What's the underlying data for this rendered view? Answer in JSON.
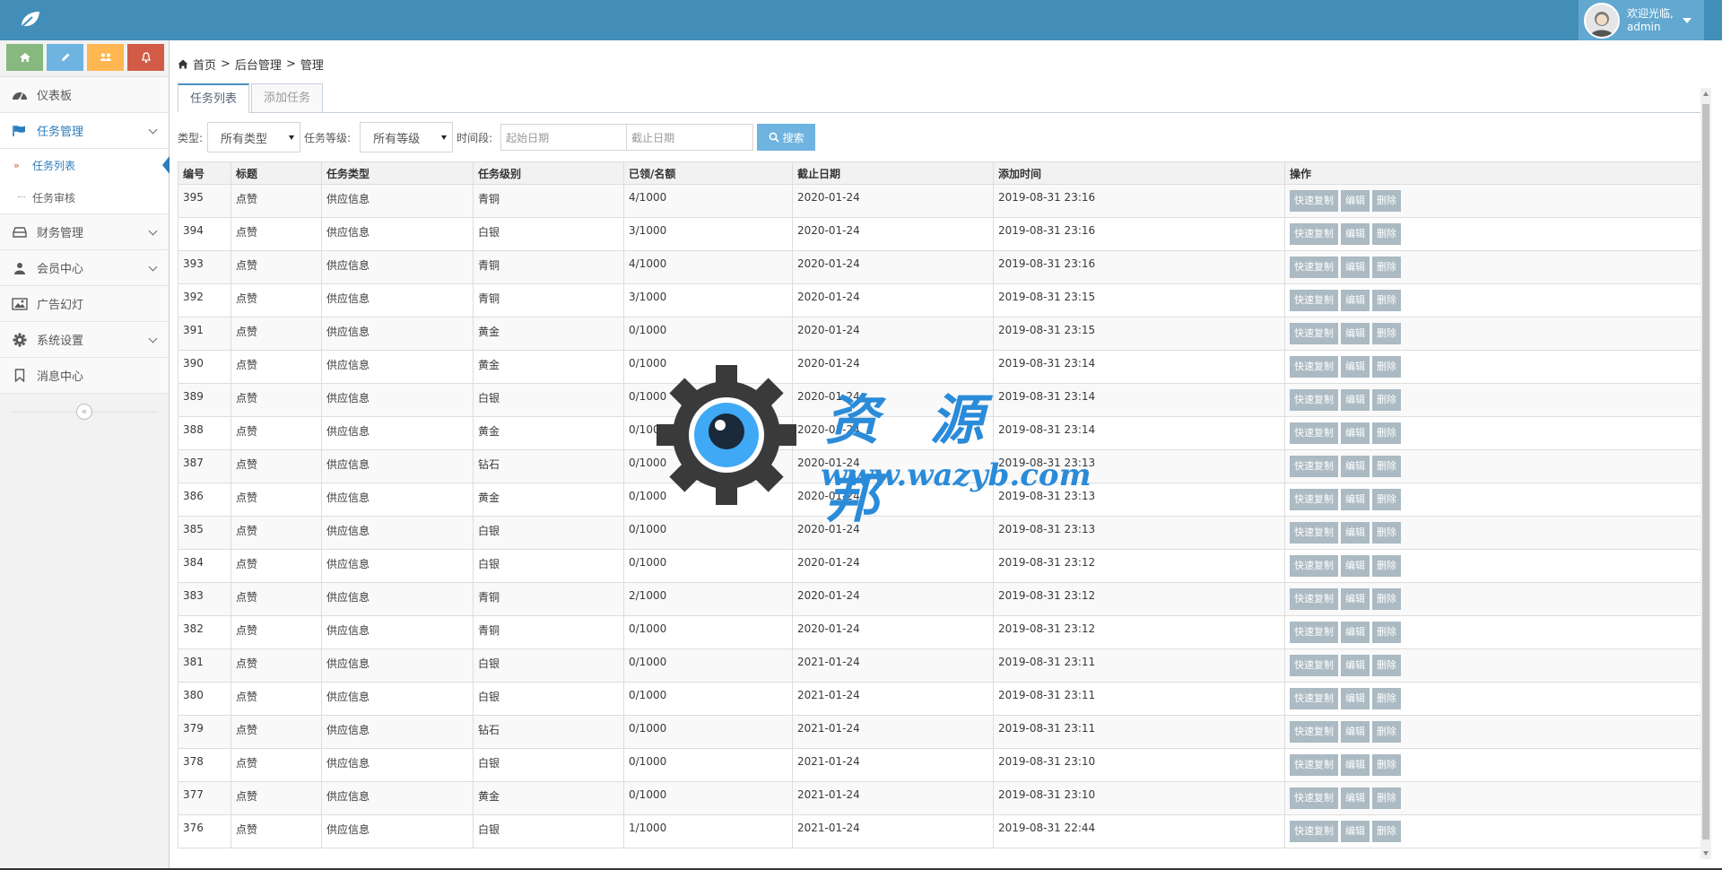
{
  "header": {
    "welcome": "欢迎光临,",
    "username": "admin"
  },
  "sidebar": {
    "shortcut_colors": [
      "#87b87f",
      "#6fb3e0",
      "#ffb752",
      "#d15b47"
    ],
    "items": [
      {
        "label": "仪表板",
        "icon": "dashboard-icon"
      },
      {
        "label": "任务管理",
        "icon": "flag-icon",
        "expanded": true
      },
      {
        "label": "财务管理",
        "icon": "hdd-icon"
      },
      {
        "label": "会员中心",
        "icon": "user-icon"
      },
      {
        "label": "广告幻灯",
        "icon": "picture-icon"
      },
      {
        "label": "系统设置",
        "icon": "cog-icon"
      },
      {
        "label": "消息中心",
        "icon": "bookmark-icon"
      }
    ],
    "submenu": [
      {
        "label": "任务列表",
        "active": true
      },
      {
        "label": "任务审核"
      }
    ]
  },
  "breadcrumb": {
    "home": "首页",
    "sep": ">",
    "level2": "后台管理",
    "level3": "管理"
  },
  "tabs": {
    "list": "任务列表",
    "add": "添加任务"
  },
  "filters": {
    "type_label": "类型:",
    "type_value": "所有类型",
    "level_label": "任务等级:",
    "level_value": "所有等级",
    "period_label": "时间段:",
    "start_placeholder": "起始日期",
    "end_placeholder": "截止日期",
    "search_label": "搜索"
  },
  "table": {
    "headers": [
      "编号",
      "标题",
      "任务类型",
      "任务级别",
      "已领/名额",
      "截止日期",
      "添加时间",
      "操作"
    ],
    "actions": [
      "快速复制",
      "编辑",
      "删除"
    ],
    "rows": [
      [
        "395",
        "点赞",
        "供应信息",
        "青铜",
        "4/1000",
        "2020-01-24",
        "2019-08-31 23:16"
      ],
      [
        "394",
        "点赞",
        "供应信息",
        "白银",
        "3/1000",
        "2020-01-24",
        "2019-08-31 23:16"
      ],
      [
        "393",
        "点赞",
        "供应信息",
        "青铜",
        "4/1000",
        "2020-01-24",
        "2019-08-31 23:16"
      ],
      [
        "392",
        "点赞",
        "供应信息",
        "青铜",
        "3/1000",
        "2020-01-24",
        "2019-08-31 23:15"
      ],
      [
        "391",
        "点赞",
        "供应信息",
        "黄金",
        "0/1000",
        "2020-01-24",
        "2019-08-31 23:15"
      ],
      [
        "390",
        "点赞",
        "供应信息",
        "黄金",
        "0/1000",
        "2020-01-24",
        "2019-08-31 23:14"
      ],
      [
        "389",
        "点赞",
        "供应信息",
        "白银",
        "0/1000",
        "2020-01-24",
        "2019-08-31 23:14"
      ],
      [
        "388",
        "点赞",
        "供应信息",
        "黄金",
        "0/1000",
        "2020-01-24",
        "2019-08-31 23:14"
      ],
      [
        "387",
        "点赞",
        "供应信息",
        "钻石",
        "0/1000",
        "2020-01-24",
        "2019-08-31 23:13"
      ],
      [
        "386",
        "点赞",
        "供应信息",
        "黄金",
        "0/1000",
        "2020-01-24",
        "2019-08-31 23:13"
      ],
      [
        "385",
        "点赞",
        "供应信息",
        "白银",
        "0/1000",
        "2020-01-24",
        "2019-08-31 23:13"
      ],
      [
        "384",
        "点赞",
        "供应信息",
        "白银",
        "0/1000",
        "2020-01-24",
        "2019-08-31 23:12"
      ],
      [
        "383",
        "点赞",
        "供应信息",
        "青铜",
        "2/1000",
        "2020-01-24",
        "2019-08-31 23:12"
      ],
      [
        "382",
        "点赞",
        "供应信息",
        "青铜",
        "0/1000",
        "2020-01-24",
        "2019-08-31 23:12"
      ],
      [
        "381",
        "点赞",
        "供应信息",
        "白银",
        "0/1000",
        "2021-01-24",
        "2019-08-31 23:11"
      ],
      [
        "380",
        "点赞",
        "供应信息",
        "白银",
        "0/1000",
        "2021-01-24",
        "2019-08-31 23:11"
      ],
      [
        "379",
        "点赞",
        "供应信息",
        "钻石",
        "0/1000",
        "2021-01-24",
        "2019-08-31 23:11"
      ],
      [
        "378",
        "点赞",
        "供应信息",
        "白银",
        "0/1000",
        "2021-01-24",
        "2019-08-31 23:10"
      ],
      [
        "377",
        "点赞",
        "供应信息",
        "黄金",
        "0/1000",
        "2021-01-24",
        "2019-08-31 23:10"
      ],
      [
        "376",
        "点赞",
        "供应信息",
        "白银",
        "1/1000",
        "2021-01-24",
        "2019-08-31 22:44"
      ]
    ]
  },
  "watermark": {
    "title": "资 源 邦",
    "url": "www.wazyb.com"
  }
}
